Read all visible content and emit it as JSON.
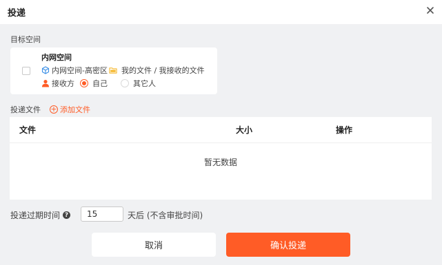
{
  "dialog": {
    "title": "投递"
  },
  "target_section": {
    "label": "目标空间"
  },
  "target_card": {
    "space_name": "内网空间",
    "location": "内网空间-高密区",
    "folder": "我的文件 / 我接收的文件",
    "recipient_label": "接收方",
    "options": [
      {
        "label": "自己",
        "checked": true
      },
      {
        "label": "其它人",
        "checked": false
      }
    ]
  },
  "files_section": {
    "label": "投递文件",
    "add_label": "添加文件"
  },
  "table": {
    "columns": [
      "文件",
      "大小",
      "操作"
    ],
    "empty_text": "暂无数据"
  },
  "expire": {
    "label": "投递过期时间",
    "help_icon": "?",
    "value": "15",
    "suffix": "天后  (不含审批时间)"
  },
  "buttons": {
    "cancel": "取消",
    "confirm": "确认投递"
  },
  "colors": {
    "accent": "#ff5c26",
    "cube_icon": "#3b8fe6",
    "folder_icon": "#f5b82e"
  }
}
